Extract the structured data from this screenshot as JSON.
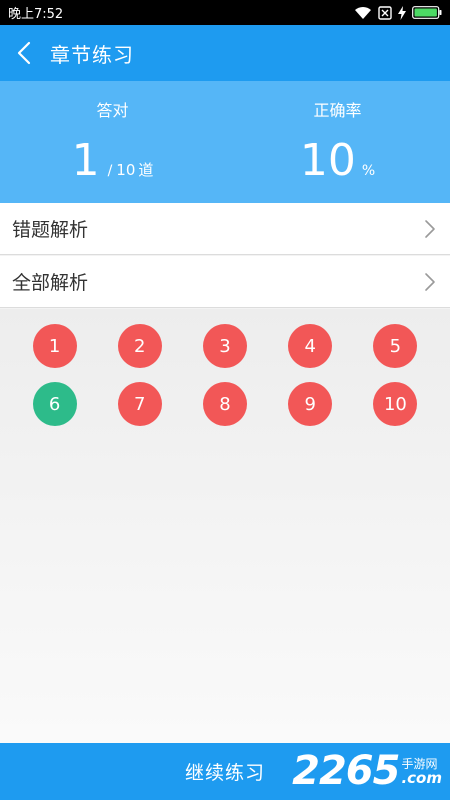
{
  "status_bar": {
    "time": "晚上7:52"
  },
  "header": {
    "title": "章节练习",
    "back_icon": "chevron-left-icon"
  },
  "stats": {
    "correct_label": "答对",
    "correct_count": "1",
    "slash": "/",
    "total_count": "10",
    "total_unit": "道",
    "accuracy_label": "正确率",
    "accuracy_value": "10",
    "accuracy_unit": "%"
  },
  "menu": {
    "wrong_analysis": "错题解析",
    "all_analysis": "全部解析"
  },
  "questions": [
    {
      "number": "1",
      "status": "wrong"
    },
    {
      "number": "2",
      "status": "wrong"
    },
    {
      "number": "3",
      "status": "wrong"
    },
    {
      "number": "4",
      "status": "wrong"
    },
    {
      "number": "5",
      "status": "wrong"
    },
    {
      "number": "6",
      "status": "correct"
    },
    {
      "number": "7",
      "status": "wrong"
    },
    {
      "number": "8",
      "status": "wrong"
    },
    {
      "number": "9",
      "status": "wrong"
    },
    {
      "number": "10",
      "status": "wrong"
    }
  ],
  "footer": {
    "continue_label": "继续练习"
  },
  "watermark": {
    "number": "2265",
    "site_cn": "手游网",
    "site_en": ".com"
  },
  "colors": {
    "primary": "#1e9bf0",
    "stats_bg": "#55b6f7",
    "wrong": "#f25757",
    "correct": "#2dbb8a"
  }
}
